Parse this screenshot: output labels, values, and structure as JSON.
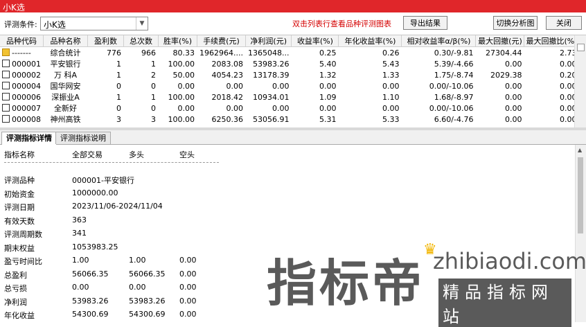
{
  "window": {
    "title": "小K选"
  },
  "toolbar": {
    "condition_label": "评测条件:",
    "condition_value": "小K选",
    "hint": "双击列表行查看品种评测图表",
    "export_label": "导出结果",
    "switch_label": "切换分析图",
    "close_label": "关闭"
  },
  "table": {
    "columns": [
      "品种代码",
      "品种名称",
      "盈利数",
      "总次数",
      "胜率(%)",
      "手续费(元)",
      "净利润(元)",
      "收益率(%)",
      "年化收益率(%)",
      "相对收益率α/β(%)",
      "最大回撤(元)",
      "最大回撤比(%)"
    ],
    "rows": [
      {
        "code": "-------",
        "name": "综合统计",
        "win": "776",
        "total": "966",
        "rate": "80.33",
        "fee": "1962964....",
        "profit": "1365048...",
        "ret": "0.25",
        "annual": "0.26",
        "rel": "0.30/-9.81",
        "dd": "27304.44",
        "ddr": "2.73",
        "summary": true
      },
      {
        "code": "000001",
        "name": "平安银行",
        "win": "1",
        "total": "1",
        "rate": "100.00",
        "fee": "2083.08",
        "profit": "53983.26",
        "ret": "5.40",
        "annual": "5.43",
        "rel": "5.39/-4.66",
        "dd": "0.00",
        "ddr": "0.00"
      },
      {
        "code": "000002",
        "name": "万 科A",
        "win": "1",
        "total": "2",
        "rate": "50.00",
        "fee": "4054.23",
        "profit": "13178.39",
        "ret": "1.32",
        "annual": "1.33",
        "rel": "1.75/-8.74",
        "dd": "2029.38",
        "ddr": "0.20"
      },
      {
        "code": "000004",
        "name": "国华网安",
        "win": "0",
        "total": "0",
        "rate": "0.00",
        "fee": "0.00",
        "profit": "0.00",
        "ret": "0.00",
        "annual": "0.00",
        "rel": "0.00/-10.06",
        "dd": "0.00",
        "ddr": "0.00"
      },
      {
        "code": "000006",
        "name": "深振业A",
        "win": "1",
        "total": "1",
        "rate": "100.00",
        "fee": "2018.42",
        "profit": "10934.01",
        "ret": "1.09",
        "annual": "1.10",
        "rel": "1.68/-8.97",
        "dd": "0.00",
        "ddr": "0.00"
      },
      {
        "code": "000007",
        "name": "全新好",
        "win": "0",
        "total": "0",
        "rate": "0.00",
        "fee": "0.00",
        "profit": "0.00",
        "ret": "0.00",
        "annual": "0.00",
        "rel": "0.00/-10.06",
        "dd": "0.00",
        "ddr": "0.00"
      },
      {
        "code": "000008",
        "name": "神州高铁",
        "win": "3",
        "total": "3",
        "rate": "100.00",
        "fee": "6250.36",
        "profit": "53056.91",
        "ret": "5.31",
        "annual": "5.33",
        "rel": "6.60/-4.76",
        "dd": "0.00",
        "ddr": "0.00"
      }
    ]
  },
  "tabs": [
    {
      "label": "评测指标详情",
      "active": true
    },
    {
      "label": "评测指标说明",
      "active": false
    }
  ],
  "detail": {
    "header": [
      "指标名称",
      "全部交易",
      "多头",
      "空头"
    ],
    "rows": [
      {
        "label": "评测品种",
        "v1": "000001-平安银行",
        "v2": "",
        "v3": ""
      },
      {
        "label": "初始资金",
        "v1": "1000000.00",
        "v2": "",
        "v3": ""
      },
      {
        "label": "评测日期",
        "v1": "2023/11/06-2024/11/04",
        "v2": "",
        "v3": ""
      },
      {
        "label": "有效天数",
        "v1": "363",
        "v2": "",
        "v3": ""
      },
      {
        "label": "评测周期数",
        "v1": "341",
        "v2": "",
        "v3": ""
      },
      {
        "label": "期末权益",
        "v1": "1053983.25",
        "v2": "",
        "v3": ""
      },
      {
        "label": "盈亏时间比",
        "v1": "1.00",
        "v2": "1.00",
        "v3": "0.00"
      },
      {
        "label": "总盈利",
        "v1": "56066.35",
        "v2": "56066.35",
        "v3": "0.00"
      },
      {
        "label": "总亏损",
        "v1": "0.00",
        "v2": "0.00",
        "v3": "0.00"
      },
      {
        "label": "净利润",
        "v1": "53983.26",
        "v2": "53983.26",
        "v3": "0.00"
      },
      {
        "label": "年化收益",
        "v1": "54300.69",
        "v2": "54300.69",
        "v3": "0.00"
      }
    ]
  },
  "watermark": {
    "main": "指标帝",
    "url": "zhibiaodi.com",
    "sub": "精品指标网站"
  }
}
